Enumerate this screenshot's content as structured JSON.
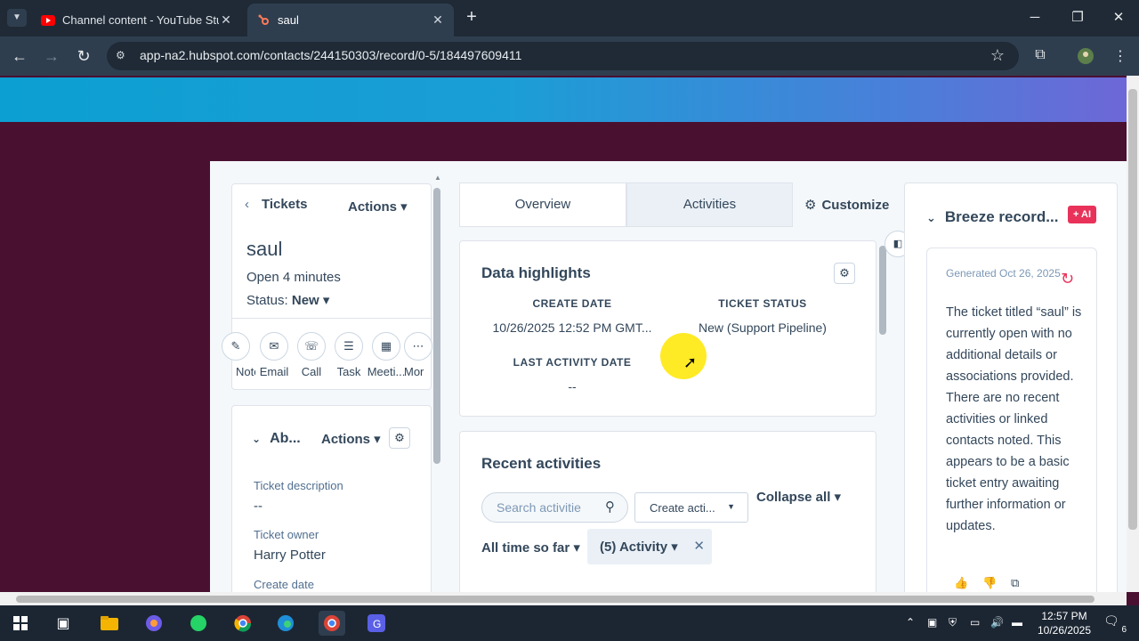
{
  "browser": {
    "tabs": [
      {
        "title": "Channel content - YouTube Stu",
        "icon": "youtube-icon"
      },
      {
        "title": "saul",
        "icon": "hubspot-icon"
      }
    ],
    "url": "app-na2.hubspot.com/contacts/244150303/record/0-5/184497609411"
  },
  "record": {
    "back_label": "Tickets",
    "actions_label": "Actions",
    "name": "saul",
    "open_time": "Open 4 minutes",
    "status_prefix": "Status:",
    "status_value": "New",
    "quick_actions": [
      "Note",
      "Email",
      "Call",
      "Task",
      "Meeti...",
      "Mor"
    ]
  },
  "about": {
    "title": "Ab...",
    "actions_label": "Actions",
    "properties": [
      {
        "label": "Ticket description",
        "value": "--"
      },
      {
        "label": "Ticket owner",
        "value": "Harry Potter"
      },
      {
        "label": "Create date",
        "value": ""
      }
    ]
  },
  "middle": {
    "tabs": [
      "Overview",
      "Activities"
    ],
    "customize_label": "Customize",
    "highlights": {
      "title": "Data highlights",
      "fields": [
        {
          "label": "CREATE DATE",
          "value": "10/26/2025 12:52 PM GMT..."
        },
        {
          "label": "TICKET STATUS",
          "value": "New (Support Pipeline)"
        },
        {
          "label": "LAST ACTIVITY DATE",
          "value": "--"
        }
      ]
    },
    "recent": {
      "title": "Recent activities",
      "search_placeholder": "Search activitie",
      "create_label": "Create acti...",
      "collapse_label": "Collapse all",
      "time_filter": "All time so far",
      "activity_filter": "(5) Activity"
    }
  },
  "breeze": {
    "title": "Breeze record...",
    "ai_badge": "+ AI",
    "generated": "Generated Oct 26, 2025",
    "summary": "The ticket titled “saul” is currently open with no additional details or associations provided. There are no recent activities or linked contacts noted. This appears to be a basic ticket entry awaiting further information or updates."
  },
  "taskbar": {
    "time": "12:57 PM",
    "date": "10/26/2025",
    "notifications": "6"
  },
  "colors": {
    "page_bg": "#4a1030",
    "accent": "#e8325a",
    "text": "#33475b"
  }
}
